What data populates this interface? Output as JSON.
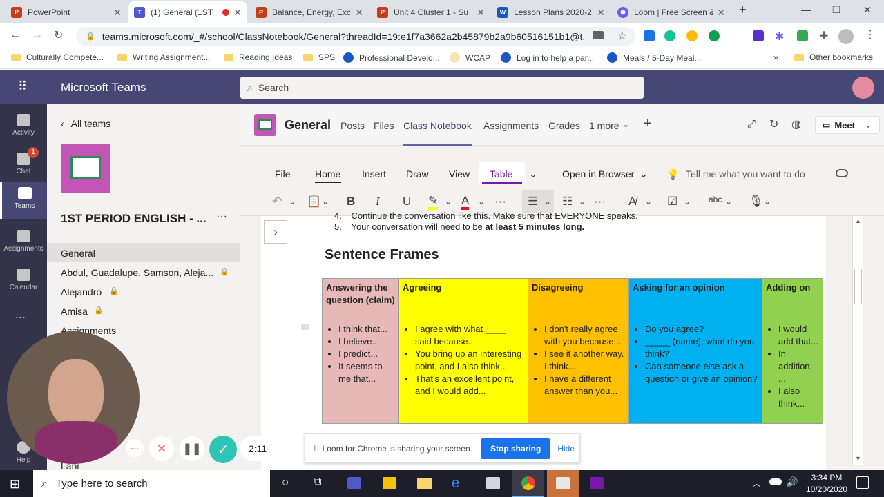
{
  "browser": {
    "tabs": [
      {
        "title": "PowerPoint",
        "color": "#c43e1c"
      },
      {
        "title": "(1) General (1ST",
        "color": "#5059c9"
      },
      {
        "title": "Balance, Energy, Exc",
        "color": "#c43e1c"
      },
      {
        "title": "Unit 4 Cluster 1 - Su",
        "color": "#c43e1c"
      },
      {
        "title": "Lesson Plans 2020-2",
        "color": "#185abd"
      },
      {
        "title": "Loom | Free Screen &",
        "color": "#625df5"
      }
    ],
    "url": "teams.microsoft.com/_#/school/ClassNotebook/General?threadId=19:e1f7a3662a2b45879b2a9b60516151b1@t...",
    "bookmarks": [
      "Culturally Compete...",
      "Writing Assignment...",
      "Reading Ideas",
      "SPS",
      "Professional Develo...",
      "WCAP",
      "Log in to help a par...",
      "Meals / 5-Day Meal..."
    ],
    "other_bookmarks": "Other bookmarks",
    "more_bookmarks": "»"
  },
  "teams": {
    "app_title": "Microsoft Teams",
    "search_placeholder": "Search",
    "rail": [
      {
        "label": "Activity",
        "badge": ""
      },
      {
        "label": "Chat",
        "badge": "1"
      },
      {
        "label": "Teams",
        "badge": ""
      },
      {
        "label": "Assignments",
        "badge": ""
      },
      {
        "label": "Calendar",
        "badge": ""
      },
      {
        "label": "Help",
        "badge": ""
      }
    ],
    "rail_more": "...",
    "back_label": "All teams",
    "team_name": "1ST PERIOD ENGLISH - ...",
    "team_more": "···",
    "channels": [
      "General",
      "Abdul, Guadalupe, Samson, Aleja...",
      "Alejandro",
      "Amisa",
      "Assignments",
      "Lani"
    ],
    "channel_name": "General",
    "channel_tabs": [
      "Posts",
      "Files",
      "Class Notebook",
      "Assignments",
      "Grades",
      "1 more"
    ],
    "meet_label": "Meet"
  },
  "ribbon": {
    "tabs": [
      "File",
      "Home",
      "Insert",
      "Draw",
      "View",
      "Table"
    ],
    "open_in_browser": "Open in Browser",
    "tell_me": "Tell me what you want to do",
    "bold": "B",
    "italic": "I",
    "underline": "U",
    "tool_more": "···"
  },
  "notebook": {
    "list_items": [
      {
        "num": "4.",
        "text": "Continue the conversation like this. Make sure that EVERYONE speaks."
      },
      {
        "num": "5.",
        "text": "Your conversation will need to be ",
        "bold": "at least 5 minutes long."
      }
    ],
    "heading": "Sentence Frames",
    "headers": [
      "Answering the question (claim)",
      "Agreeing",
      "Disagreeing",
      "Asking for an opinion",
      "Adding on"
    ],
    "cells": [
      [
        "I think that...",
        "I believe...",
        "I predict...",
        "It seems to me that..."
      ],
      [
        "I agree with what ____ said because...",
        "You bring up an interesting point, and I also think...",
        "That's an excellent point, and I would add..."
      ],
      [
        "I don't really agree with you because...",
        "I see it another way.  I think...",
        "I have a different answer than you..."
      ],
      [
        "Do you agree?",
        "_____ (name), what do you think?",
        "Can someone else ask a question or give an opinion?"
      ],
      [
        "I would add that...",
        "In addition, ...",
        "I also think..."
      ]
    ],
    "colors": {
      "col1": "#e6b8b7",
      "col2": "#ffff00",
      "col3": "#ffc000",
      "col4": "#00b0f0",
      "col5": "#92d050"
    }
  },
  "loom": {
    "timer": "2:11",
    "more": "···",
    "sharing_text": "Loom for Chrome is sharing your screen.",
    "stop_label": "Stop sharing",
    "hide_label": "Hide"
  },
  "taskbar": {
    "search_placeholder": "Type here to search",
    "time": "3:34 PM",
    "date": "10/20/2020"
  }
}
